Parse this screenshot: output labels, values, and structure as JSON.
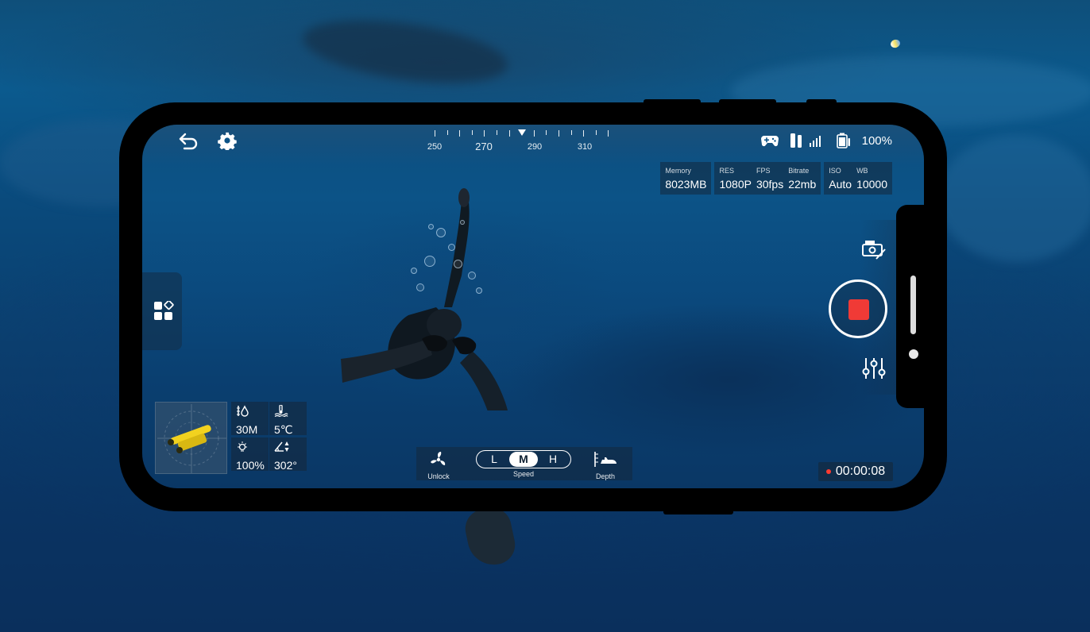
{
  "compass": {
    "ticks_label_minor": [
      "250",
      "290",
      "310"
    ],
    "label_major": "270",
    "labels": [
      {
        "text": "250",
        "major": false
      },
      {
        "text": "270",
        "major": true
      },
      {
        "text": "290",
        "major": false
      },
      {
        "text": "310",
        "major": false
      }
    ],
    "heading_marker": "heading"
  },
  "status": {
    "controller_icon": "gamepad-icon",
    "signal_icon": "signal-strength-icon",
    "battery_icon": "battery-icon",
    "battery_text": "100%"
  },
  "info": {
    "memory_label": "Memory",
    "memory_value": "8023MB",
    "res_label": "RES",
    "res_value": "1080P",
    "fps_label": "FPS",
    "fps_value": "30fps",
    "bitrate_label": "Bitrate",
    "bitrate_value": "22mb",
    "iso_label": "ISO",
    "iso_value": "Auto",
    "wb_label": "WB",
    "wb_value": "10000"
  },
  "telemetry": {
    "depth_value": "30M",
    "temperature_value": "5℃",
    "light_value": "100%",
    "heading_value": "302°"
  },
  "controls": {
    "unlock_label": "Unlock",
    "speed_label": "Speed",
    "speed_options": [
      "L",
      "M",
      "H"
    ],
    "speed_selected": "M",
    "depth_label": "Depth"
  },
  "recording": {
    "timer": "00:00:08",
    "state": "recording"
  },
  "colors": {
    "record_red": "#f03a36",
    "drone_yellow": "#f2d21f",
    "water_blue": "#0b4a7e"
  }
}
